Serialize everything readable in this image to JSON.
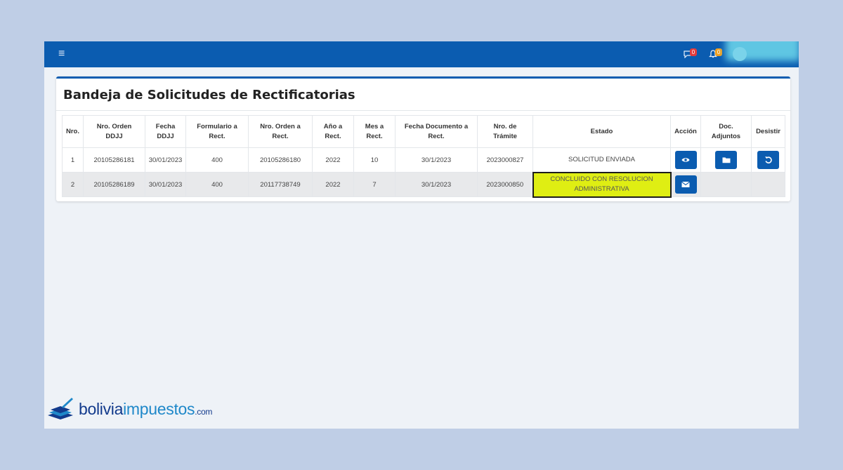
{
  "topbar": {
    "menu_icon": "hamburger-icon",
    "messages_count": "0",
    "alerts_count": "0"
  },
  "card": {
    "title": "Bandeja de Solicitudes de Rectificatorias"
  },
  "table": {
    "headers": {
      "nro": "Nro.",
      "orden_ddjj_1": "Nro. Orden",
      "orden_ddjj_2": "DDJJ",
      "fecha_ddjj_1": "Fecha",
      "fecha_ddjj_2": "DDJJ",
      "form_1": "Formulario a",
      "form_2": "Rect.",
      "orden_rect_1": "Nro. Orden a",
      "orden_rect_2": "Rect.",
      "anio_1": "Año a",
      "anio_2": "Rect.",
      "mes_1": "Mes a",
      "mes_2": "Rect.",
      "fecha_doc_1": "Fecha Documento a",
      "fecha_doc_2": "Rect.",
      "tramite_1": "Nro. de",
      "tramite_2": "Trámite",
      "estado": "Estado",
      "accion": "Acción",
      "doc_1": "Doc.",
      "doc_2": "Adjuntos",
      "desistir": "Desistir"
    },
    "rows": [
      {
        "nro": "1",
        "orden_ddjj": "20105286181",
        "fecha_ddjj": "30/01/2023",
        "formulario": "400",
        "orden_rect": "20105286180",
        "anio": "2022",
        "mes": "10",
        "fecha_doc": "30/1/2023",
        "tramite": "2023000827",
        "estado": "SOLICITUD ENVIADA"
      },
      {
        "nro": "2",
        "orden_ddjj": "20105286189",
        "fecha_ddjj": "30/01/2023",
        "formulario": "400",
        "orden_rect": "20117738749",
        "anio": "2022",
        "mes": "7",
        "fecha_doc": "30/1/2023",
        "tramite": "2023000850",
        "estado_1": "CONCLUIDO CON RESOLUCION",
        "estado_2": "ADMINISTRATIVA"
      }
    ]
  },
  "brand": {
    "part1": "bolivia",
    "part2": "impuestos",
    "part3": ".com"
  },
  "colors": {
    "topbar": "#0b5cb0",
    "button": "#0b5cb0",
    "highlight": "#dfee13",
    "background": "#bfcee6"
  }
}
